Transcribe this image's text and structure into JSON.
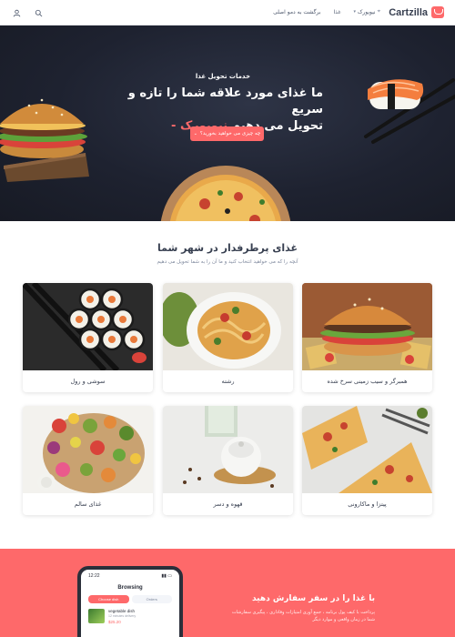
{
  "header": {
    "brand": "Cartzilla",
    "nav": {
      "city": "نیویورک",
      "food": "غذا",
      "back_to_demos": "برگشت به دمو اصلی"
    },
    "icons": [
      "search-icon",
      "user-icon"
    ]
  },
  "hero": {
    "eyebrow": "خدمات تحویل غذا",
    "title_line1": "ما غذای مورد علاقه شما را تازه و سریع",
    "title_line2": "تحویل می دهیم",
    "title_accent": "نیویورک",
    "button_label": "چه چیزی می خواهید بخورید؟"
  },
  "popular": {
    "title": "غذای پرطرفدار در شهر شما",
    "subtitle": "آنچه را که می خواهید انتخاب کنید و ما آن را به شما تحویل می دهیم",
    "categories": [
      {
        "label": "همبرگر و سیب زمینی سرخ شده"
      },
      {
        "label": "رشته"
      },
      {
        "label": "سوشی و رول"
      },
      {
        "label": "پیتزا و ماکارونی"
      },
      {
        "label": "قهوه و دسر"
      },
      {
        "label": "غذای سالم"
      }
    ]
  },
  "promo": {
    "title": "با غذا را در سفر سفارش دهید",
    "text": "پرداخت با کیف پول برنامه ، جمع آوری امتیازات وفاداری ، پیگیری سفارشات شما در زمان واقعی و موارد دیگر",
    "phone": {
      "time": "12:22",
      "title": "Browsing",
      "tab_active": "Choose dish",
      "tab_inactive": "Orders",
      "item_name": "vegetable dish",
      "item_sub": "12 minutes delivery",
      "item_price": "$25.20"
    }
  },
  "colors": {
    "accent": "#fe696a",
    "hero_bg": "#1e2230",
    "text": "#373f50"
  }
}
